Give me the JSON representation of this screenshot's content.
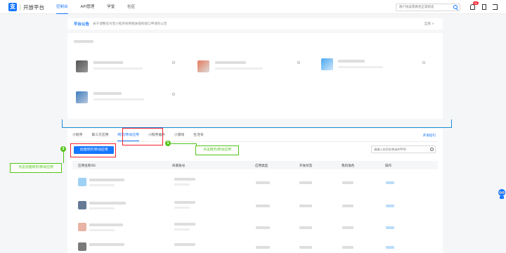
{
  "header": {
    "logo_glyph": "支",
    "title": "开放平台",
    "nav": [
      "控制台",
      "API管理",
      "学堂",
      "社区"
    ],
    "search_placeholder": "商户协议或商务正常状态",
    "notification_count": "99",
    "accent_color": "#1677ff"
  },
  "notice": {
    "title": "平台公告",
    "text": "关于调整支付宝小程序商用相关授权接口申请的公告",
    "more": "全部 >"
  },
  "tabs": {
    "items": [
      "小程序",
      "第三方应用",
      "网页/移动应用",
      "小程序插件",
      "小游戏",
      "生活号"
    ],
    "active_index": 2,
    "dev_guide": "开发指引"
  },
  "toolbar": {
    "create_button": "创建网页/移动应用",
    "search_placeholder": "请输入应用名称或APPID"
  },
  "table": {
    "columns": [
      "应用名称/ID",
      "商家账号",
      "应用类型",
      "开发状态",
      "我的角色",
      "操作"
    ]
  },
  "annotations": {
    "step1_number": "1",
    "step1_label": "点击网页/移动应用",
    "step2_number": "2",
    "step2_label": "点击创建网页/移动应用",
    "highlight_color": "#f5222d",
    "callout_color": "#52c41a"
  }
}
